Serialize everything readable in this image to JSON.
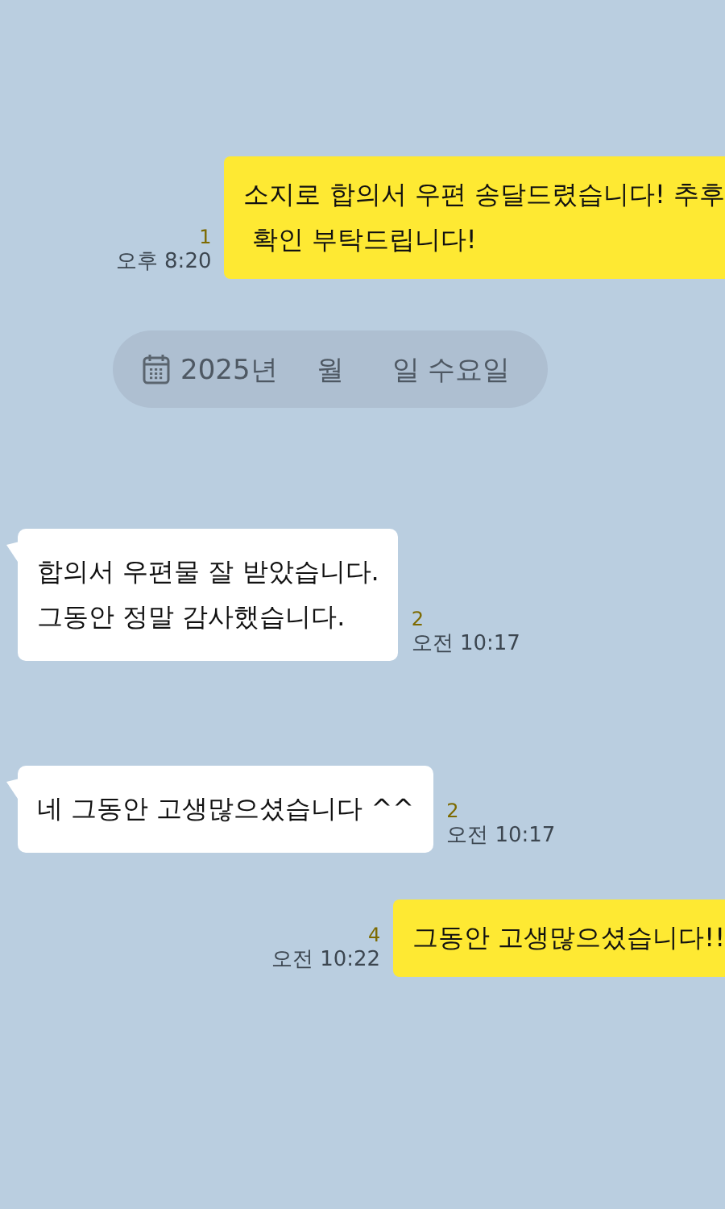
{
  "messages": [
    {
      "kind": "out",
      "text": "소지로 합의서 우편 송달드렸습니다! 추후\n 확인 부탁드립니다!",
      "unread": "1",
      "time": "오후 8:20"
    },
    {
      "kind": "date",
      "parts": [
        "2025년",
        "월",
        "일 수요일"
      ]
    },
    {
      "kind": "in",
      "text": "합의서 우편물 잘 받았습니다.\n그동안 정말 감사했습니다.",
      "unread": "2",
      "time": "오전 10:17"
    },
    {
      "kind": "in",
      "text": "네 그동안 고생많으셨습니다 ^^",
      "unread": "2",
      "time": "오전 10:17"
    },
    {
      "kind": "out",
      "text": "그동안 고생많으셨습니다!!",
      "unread": "4",
      "time": "오전 10:22"
    }
  ]
}
